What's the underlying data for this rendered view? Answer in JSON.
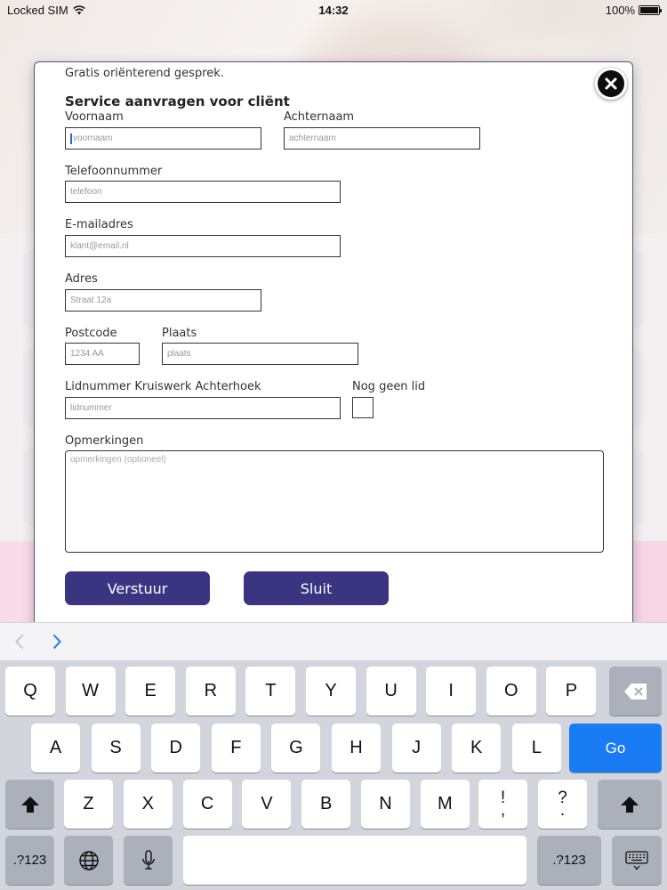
{
  "status_bar": {
    "carrier": "Locked SIM",
    "time": "14:32",
    "battery": "100%",
    "battery_level": 1.0
  },
  "form": {
    "intro": "Gratis oriënterend gesprek.",
    "title": "Service aanvragen voor cliënt",
    "fields": {
      "first_name": {
        "label": "Voornaam",
        "placeholder": "voornaam"
      },
      "last_name": {
        "label": "Achternaam",
        "placeholder": "achternaam"
      },
      "phone": {
        "label": "Telefoonnummer",
        "placeholder": "telefoon"
      },
      "email": {
        "label": "E-mailadres",
        "placeholder": "klant@email.nl"
      },
      "address": {
        "label": "Adres",
        "placeholder": "Straat 12a"
      },
      "postcode": {
        "label": "Postcode",
        "placeholder": "1234 AA"
      },
      "city": {
        "label": "Plaats",
        "placeholder": "plaats"
      },
      "member_number": {
        "label": "Lidnummer Kruiswerk Achterhoek",
        "placeholder": "lidnummer"
      },
      "not_member": {
        "label": "Nog geen lid",
        "checked": false
      },
      "remarks": {
        "label": "Opmerkingen",
        "placeholder": "opmerkingen (optioneel)"
      }
    },
    "submit_label": "Verstuur",
    "close_label": "Sluit"
  },
  "keyboard": {
    "row1": [
      "Q",
      "W",
      "E",
      "R",
      "T",
      "Y",
      "U",
      "I",
      "O",
      "P"
    ],
    "row2": [
      "A",
      "S",
      "D",
      "F",
      "G",
      "H",
      "J",
      "K",
      "L"
    ],
    "row3": [
      "Z",
      "X",
      "C",
      "V",
      "B",
      "N",
      "M"
    ],
    "punct1": [
      "!",
      ","
    ],
    "punct2": [
      "?",
      "."
    ],
    "go_label": "Go",
    "numbers_label": ".?123"
  },
  "colors": {
    "accent_button": "#3a3580",
    "go_key": "#1a7cf5"
  }
}
